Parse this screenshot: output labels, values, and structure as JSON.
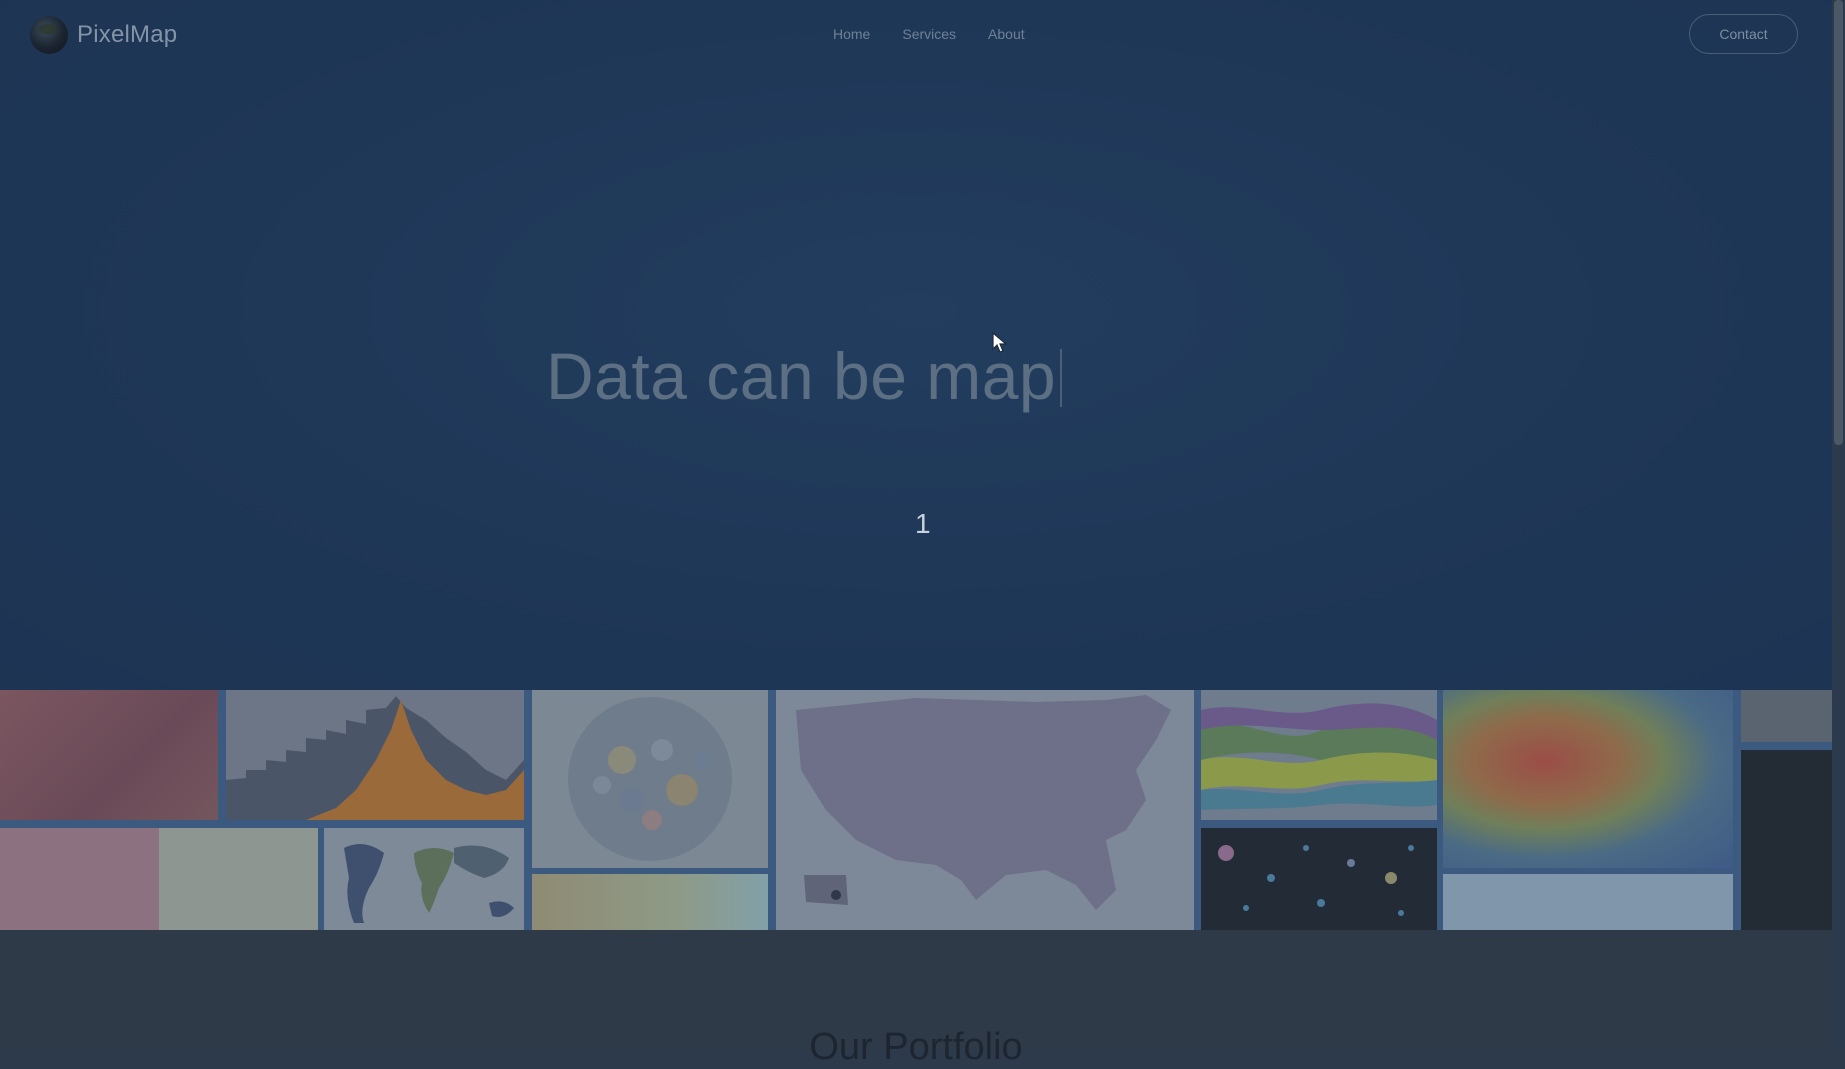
{
  "nav": {
    "brand": "PixelMap",
    "links": [
      "Home",
      "Services",
      "About"
    ],
    "contact": "Contact"
  },
  "hero": {
    "headline": "Data can be map",
    "counter": "1"
  },
  "portfolio": {
    "title": "Our Portfolio"
  },
  "colors": {
    "hero_bg": "#1f3757",
    "accent_blue": "#3c5a80"
  },
  "icons": [
    "logo-globe-icon",
    "mouse-cursor-icon"
  ]
}
